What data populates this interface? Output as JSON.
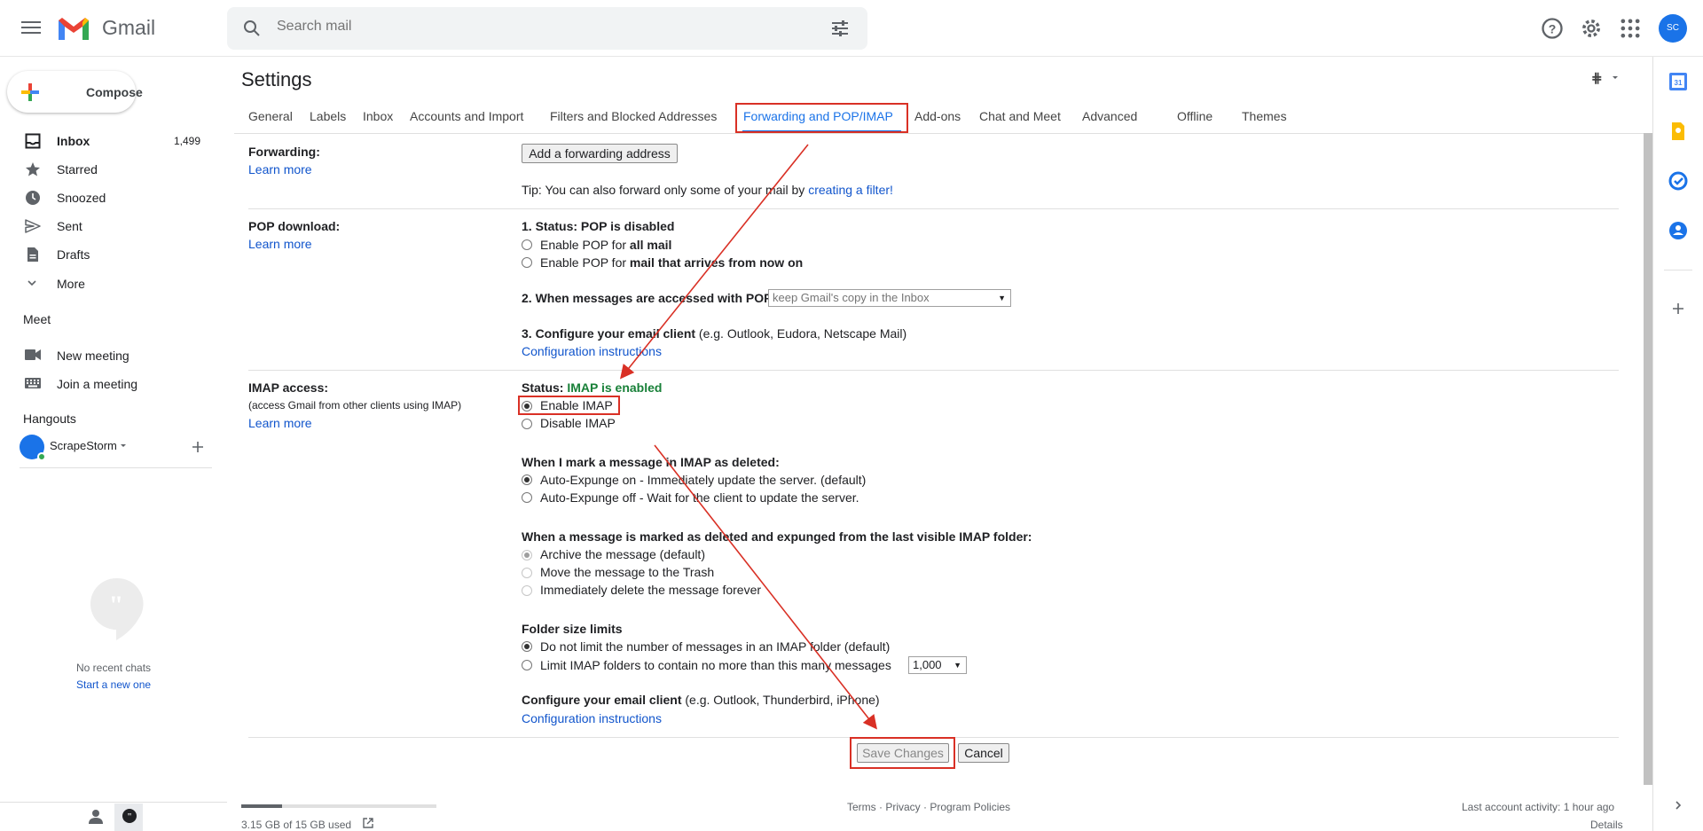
{
  "app": {
    "name": "Gmail"
  },
  "search": {
    "placeholder": "Search mail"
  },
  "avatar_text": "SC",
  "compose": {
    "label": "Compose"
  },
  "sidebar": {
    "items": [
      {
        "label": "Inbox",
        "count": "1,499"
      },
      {
        "label": "Starred"
      },
      {
        "label": "Snoozed"
      },
      {
        "label": "Sent"
      },
      {
        "label": "Drafts"
      },
      {
        "label": "More"
      }
    ],
    "meet_title": "Meet",
    "meet_items": [
      "New meeting",
      "Join a meeting"
    ],
    "hangouts_title": "Hangouts",
    "hangouts_user": "ScrapeStorm",
    "no_chats": "No recent chats",
    "start_chat": "Start a new one"
  },
  "settings": {
    "title": "Settings",
    "tabs": [
      "General",
      "Labels",
      "Inbox",
      "Accounts and Import",
      "Filters and Blocked Addresses",
      "Forwarding and POP/IMAP",
      "Add-ons",
      "Chat and Meet",
      "Advanced",
      "Offline",
      "Themes"
    ],
    "forwarding": {
      "label": "Forwarding:",
      "learn_more": "Learn more",
      "add_button": "Add a forwarding address",
      "tip_prefix": "Tip: You can also forward only some of your mail by ",
      "tip_link": "creating a filter!"
    },
    "pop": {
      "label": "POP download:",
      "learn_more": "Learn more",
      "status": "1. Status: POP is disabled",
      "opt1_prefix": "Enable POP for ",
      "opt1_bold": "all mail",
      "opt2_prefix": "Enable POP for ",
      "opt2_bold": "mail that arrives from now on",
      "q2": "2. When messages are accessed with POP",
      "q2_select": "keep Gmail's copy in the Inbox",
      "q3_bold": "3. Configure your email client",
      "q3_rest": " (e.g. Outlook, Eudora, Netscape Mail)",
      "config_link": "Configuration instructions"
    },
    "imap": {
      "label": "IMAP access:",
      "sublabel": "(access Gmail from other clients using IMAP)",
      "learn_more": "Learn more",
      "status_prefix": "Status: ",
      "status_value": "IMAP is enabled",
      "enable": "Enable IMAP",
      "disable": "Disable IMAP",
      "deleted_title": "When I mark a message in IMAP as deleted:",
      "deleted_opts": [
        "Auto-Expunge on - Immediately update the server. (default)",
        "Auto-Expunge off - Wait for the client to update the server."
      ],
      "expunged_title": "When a message is marked as deleted and expunged from the last visible IMAP folder:",
      "expunged_opts": [
        "Archive the message (default)",
        "Move the message to the Trash",
        "Immediately delete the message forever"
      ],
      "folder_title": "Folder size limits",
      "folder_opts": [
        "Do not limit the number of messages in an IMAP folder (default)",
        "Limit IMAP folders to contain no more than this many messages"
      ],
      "folder_select": "1,000",
      "client_bold": "Configure your email client",
      "client_rest": " (e.g. Outlook, Thunderbird, iPhone)",
      "config_link": "Configuration instructions"
    },
    "save_button": "Save Changes",
    "cancel_button": "Cancel"
  },
  "footer": {
    "storage": "3.15 GB of 15 GB used",
    "storage_fraction": 0.21,
    "links": "Terms · Privacy · Program Policies",
    "activity": "Last account activity: 1 hour ago",
    "details": "Details"
  },
  "colors": {
    "accent": "#1a73e8",
    "annotation": "#d93025",
    "enabled": "#188038"
  }
}
